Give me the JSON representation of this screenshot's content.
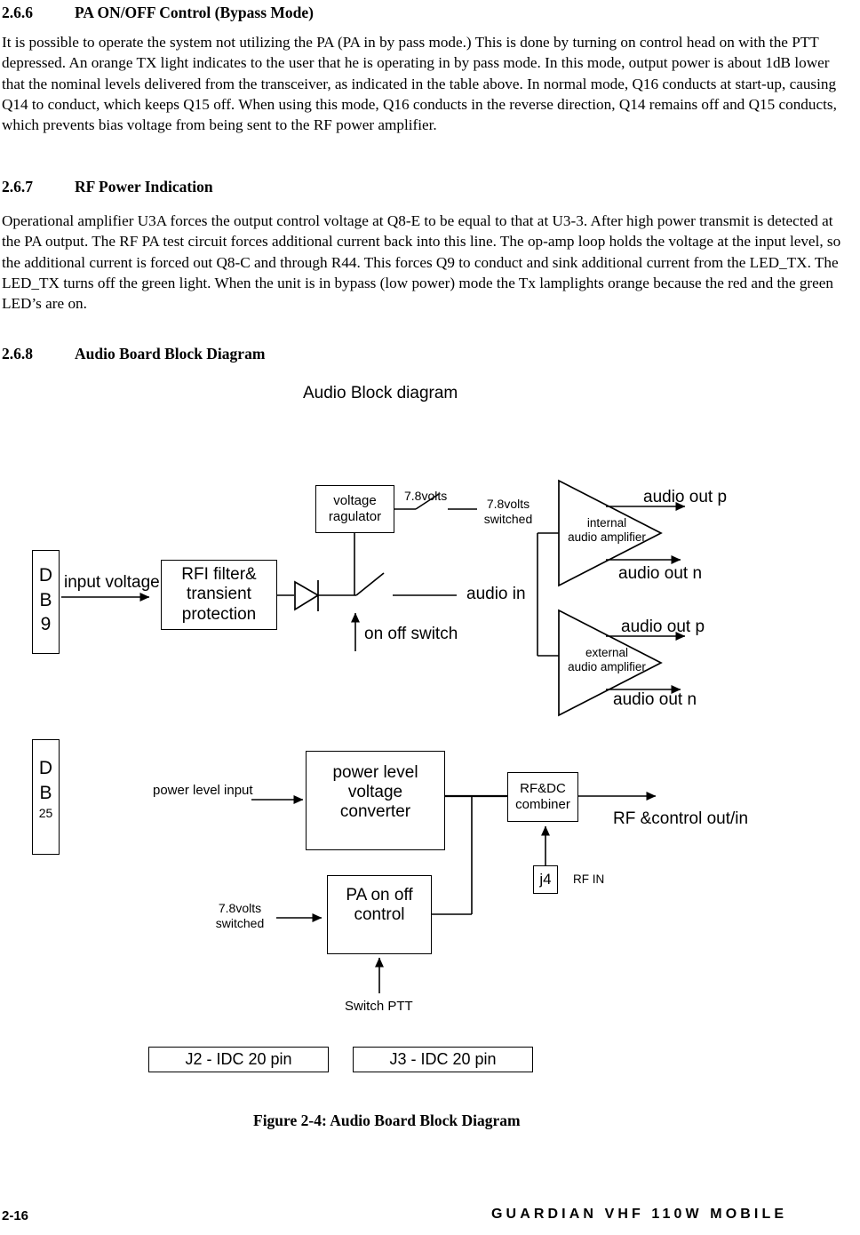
{
  "document": {
    "sections": [
      {
        "number": "2.6.6",
        "title": "PA ON/OFF Control (Bypass Mode)",
        "body": "It is possible to operate the system not utilizing the PA  (PA in by pass mode.) This is done by turning on control head on with the PTT depressed.  An orange TX light indicates to the user that he is operating in by pass mode.  In this mode, output power is about 1dB lower that the nominal levels delivered from the transceiver, as indicated in the table above. In normal mode, Q16 conducts at start-up, causing Q14 to conduct, which keeps Q15 off. When using this mode, Q16 conducts in the reverse direction, Q14 remains off and Q15 conducts, which prevents bias voltage from being sent to the RF power amplifier."
      },
      {
        "number": "2.6.7",
        "title": "RF Power Indication",
        "body": "Operational amplifier U3A forces the output control voltage at Q8-E to be equal to that at U3-3. After high power transmit is detected at the PA output. The RF PA test circuit forces additional current back into this line. The op-amp loop holds the voltage at the input level, so the additional current is forced out Q8-C and through R44. This forces Q9 to conduct and sink additional current from the LED_TX. The LED_TX turns off the green light.  When the unit is in bypass (low power) mode the Tx lamplights orange because the red and the green LED’s are on."
      },
      {
        "number": "2.6.8",
        "title": "Audio Board Block Diagram",
        "body": ""
      }
    ],
    "figure_caption": "Figure 2-4:  Audio Board Block Diagram",
    "footer": {
      "page_number": "2-16",
      "manual_title": "GUARDIAN VHF 110W MOBILE"
    }
  },
  "diagram": {
    "title": "Audio Block diagram",
    "connectors": {
      "db9": {
        "line1": "D",
        "line2": "B",
        "line3": "9"
      },
      "db25": {
        "line1": "D",
        "line2": "B",
        "line3": "25"
      },
      "j4": "j4",
      "j4_label": "RF IN",
      "j2": "J2 - IDC 20 pin",
      "j3": "J3 - IDC 20 pin"
    },
    "blocks": {
      "rfi_filter": "RFI filter&\ntransient\nprotection",
      "voltage_regulator": "voltage\nragulator",
      "power_level_converter": "power level\nvoltage\nconverter",
      "pa_on_off": "PA on off\ncontrol",
      "rf_dc_combiner": "RF&DC\ncombiner",
      "internal_amp": "internal\naudio amplifier",
      "external_amp": "external\naudio amplifier"
    },
    "labels": {
      "input_voltage": "input voltage",
      "volts_78": "7.8volts",
      "volts_78_switched": "7.8volts\nswitched",
      "on_off_switch": "on off switch",
      "audio_in": "audio in",
      "audio_out_p_internal": "audio out p",
      "audio_out_n_internal": "audio out n",
      "audio_out_p_external": "audio out p",
      "audio_out_n_external": "audio out n",
      "power_level_input": "power level input",
      "volts_78_switched_pa": "7.8volts\nswitched",
      "rf_control_out_in": "RF &control out/in",
      "switch_ptt": "Switch PTT"
    }
  }
}
